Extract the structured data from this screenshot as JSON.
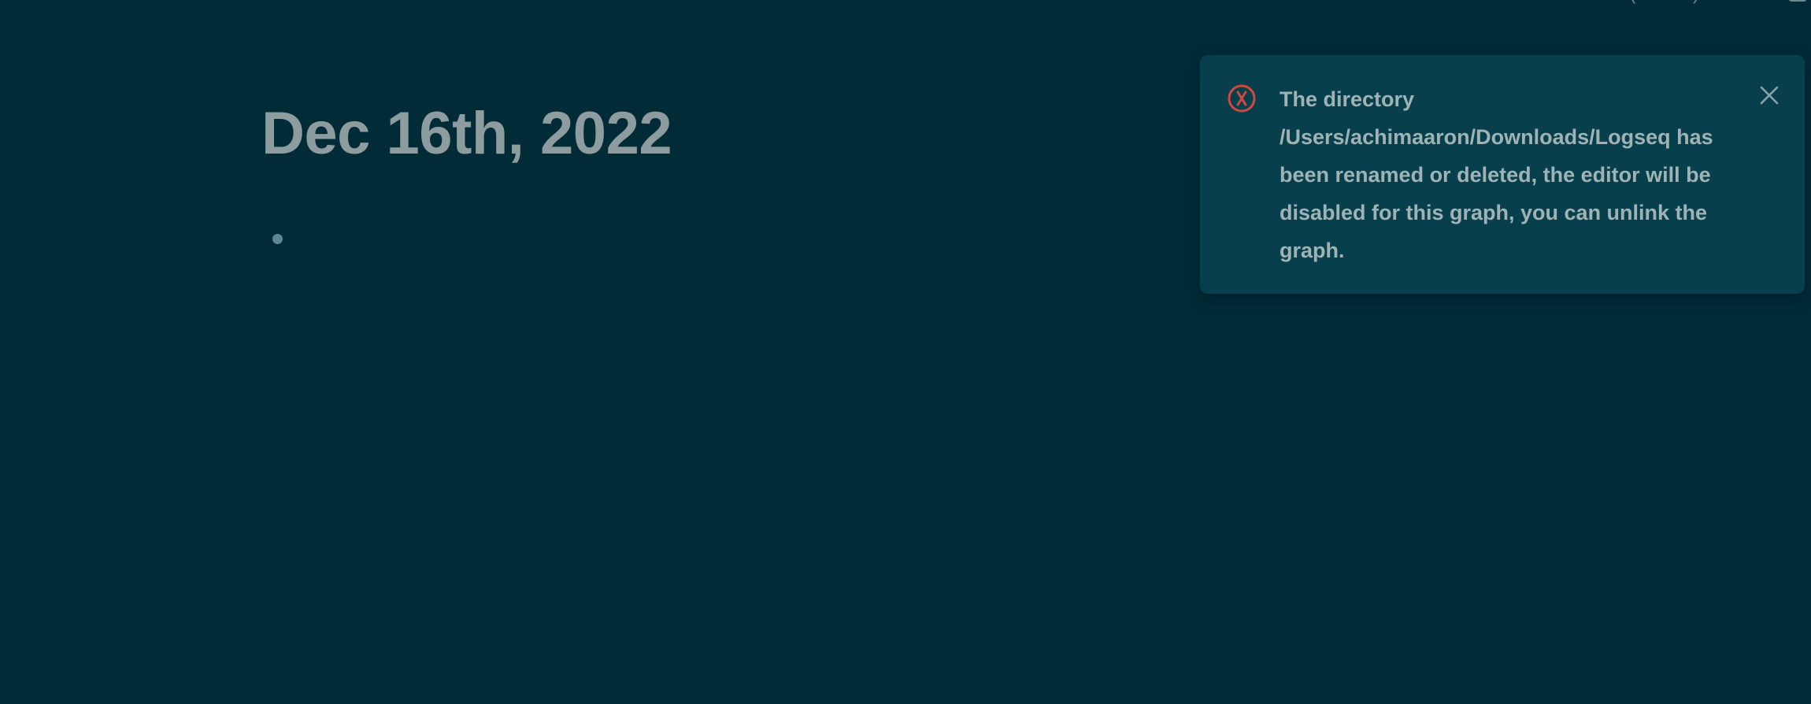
{
  "page": {
    "title": "Dec 16th, 2022"
  },
  "toast": {
    "type": "error",
    "icon": "error-circle-icon",
    "message": "The directory /Users/achimaaron/Downloads/Logseq has been renamed or deleted, the editor will be disabled for this graph, you can unlink the graph.",
    "close_icon": "close-icon"
  },
  "colors": {
    "background": "#002b37",
    "toast_background": "#073f4d",
    "title": "#8d9c9e",
    "bullet": "#5c8790",
    "error": "#d1483f",
    "toast_text": "#9fb3b4"
  }
}
